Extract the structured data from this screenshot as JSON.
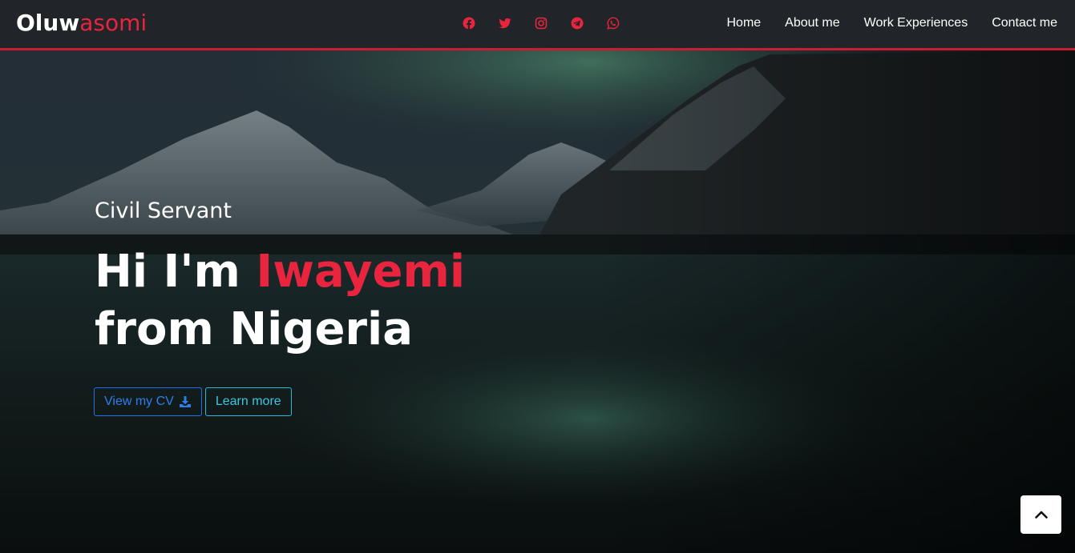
{
  "brand": {
    "first": "Oluw",
    "accent": "asomi"
  },
  "socials": [
    {
      "icon": "facebook-icon"
    },
    {
      "icon": "twitter-icon"
    },
    {
      "icon": "instagram-icon"
    },
    {
      "icon": "telegram-icon"
    },
    {
      "icon": "whatsapp-icon"
    }
  ],
  "nav": {
    "home": "Home",
    "about": "About me",
    "work": "Work Experiences",
    "contact": "Contact me"
  },
  "hero": {
    "subtitle": "Civil Servant",
    "greeting": "Hi I'm ",
    "name": "Iwayemi",
    "origin": "from Nigeria",
    "cv_label": "View my CV",
    "learn_label": "Learn more"
  },
  "colors": {
    "accent": "#e8243f",
    "navbar": "#212428",
    "navbar_border": "#c81e34",
    "cv_button": "#1a72e8",
    "learn_button": "#27b9d6"
  },
  "icons": {
    "download": "download-icon",
    "scroll_top": "chevron-up-icon"
  }
}
